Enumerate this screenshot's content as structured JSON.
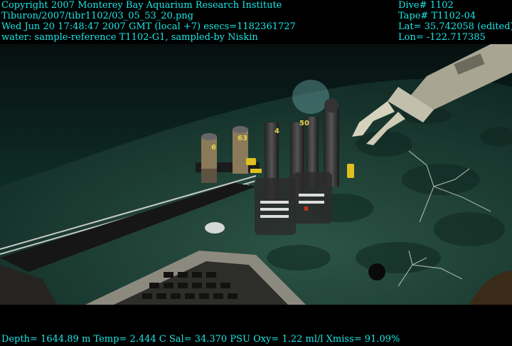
{
  "overlay": {
    "left": {
      "line1": "Copyright 2007 Monterey Bay Aquarium Research Institute",
      "line2": "Tiburon/2007/tibr1102/03_05_53_20.png",
      "line3": "Wed Jun 20 17:48:47 2007 GMT (local +7)  esecs=1182361727",
      "line4": "water: sample-reference T1102-G1, sampled-by Niskin"
    },
    "right": {
      "line1": "Dive# 1102",
      "line2": "Tape# T1102-04",
      "line3": "Lat= 35.742058 (edited)",
      "line4": "Lon= -122.717385"
    },
    "bottom": "Depth= 1644.89 m  Temp= 2.444 C  Sal= 34.370 PSU  Oxy= 1.22 ml/l  Xmiss= 91.09%"
  },
  "sampler_labels": [
    "6",
    "63",
    "4",
    "50"
  ],
  "colors": {
    "overlay_text": "#1ee6e6",
    "water": "#0d2a26",
    "seafloor": "#1f4238",
    "hardware": "#b9b7a6"
  }
}
